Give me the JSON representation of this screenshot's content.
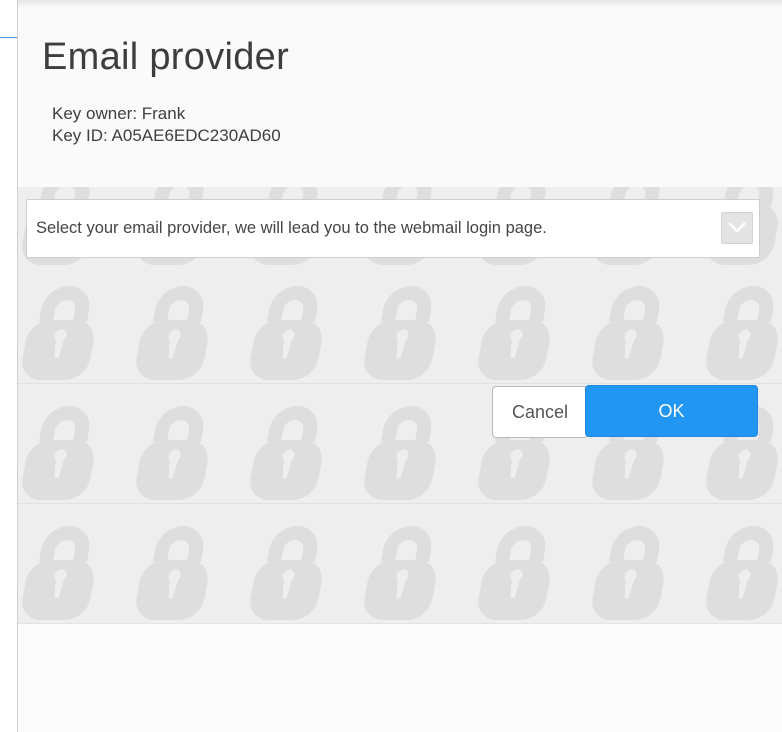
{
  "dialog": {
    "title": "Email provider",
    "key_owner": "Key owner: Frank",
    "key_id": "Key ID: A05AE6EDC230AD60"
  },
  "provider_select": {
    "placeholder": "Select your email provider, we will lead you to the webmail login page."
  },
  "buttons": {
    "cancel_label": "Cancel",
    "ok_label": "OK"
  },
  "colors": {
    "accent": "#2196f3",
    "pattern_bg": "#eeeeee",
    "lock_icon": "#dedede"
  },
  "icons": {
    "background_pattern": "padlock-icon",
    "select_chevron": "chevron-down-icon",
    "close": "close-icon"
  }
}
